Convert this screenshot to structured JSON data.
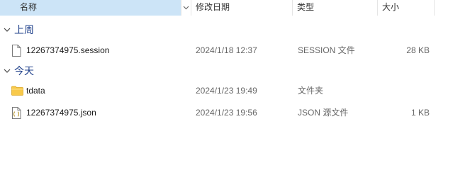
{
  "columns": {
    "name": "名称",
    "date": "修改日期",
    "type": "类型",
    "size": "大小"
  },
  "groups": [
    {
      "label": "上周",
      "files": [
        {
          "icon": "generic-file-icon",
          "name": "12267374975.session",
          "date": "2024/1/18 12:37",
          "type": "SESSION 文件",
          "size": "28 KB"
        }
      ]
    },
    {
      "label": "今天",
      "files": [
        {
          "icon": "folder-icon",
          "name": "tdata",
          "date": "2024/1/23 19:49",
          "type": "文件夹",
          "size": ""
        },
        {
          "icon": "json-file-icon",
          "name": "12267374975.json",
          "date": "2024/1/23 19:56",
          "type": "JSON 源文件",
          "size": "1 KB"
        }
      ]
    }
  ],
  "colors": {
    "header_selected": "#cce4f7",
    "group_label": "#1e3f8a",
    "folder": "#f8c94a"
  }
}
